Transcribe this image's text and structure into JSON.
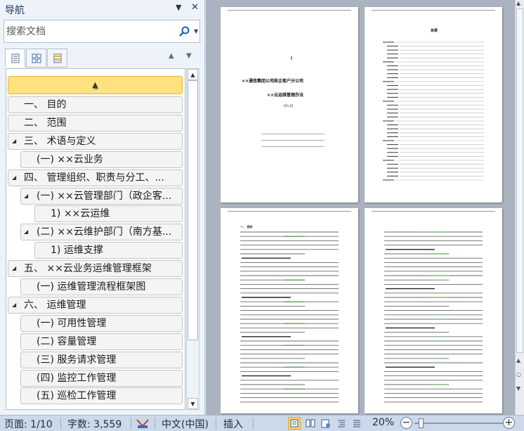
{
  "nav": {
    "title": "导航",
    "search": {
      "placeholder": "搜索文档"
    },
    "view_tabs": [
      "headings-view",
      "pages-view",
      "results-view"
    ],
    "headings": [
      {
        "level": 1,
        "label": "一、 目的",
        "expandable": false
      },
      {
        "level": 1,
        "label": "二、 范围",
        "expandable": false
      },
      {
        "level": 1,
        "label": "三、 术语与定义",
        "expandable": true
      },
      {
        "level": 2,
        "label": "(一) ××云业务",
        "expandable": false
      },
      {
        "level": 1,
        "label": "四、 管理组织、职责与分工、...",
        "expandable": true
      },
      {
        "level": 2,
        "label": "(一) ××云管理部门（政企客...",
        "expandable": true
      },
      {
        "level": 3,
        "label": "1) ××云运维",
        "expandable": false
      },
      {
        "level": 2,
        "label": "(二) ××云维护部门（南方基...",
        "expandable": true
      },
      {
        "level": 3,
        "label": "1) 运维支撑",
        "expandable": false
      },
      {
        "level": 1,
        "label": "五、 ××云业务运维管理框架",
        "expandable": true
      },
      {
        "level": 2,
        "label": "(一) 运维管理流程框架图",
        "expandable": false
      },
      {
        "level": 1,
        "label": "六、 运维管理",
        "expandable": true
      },
      {
        "level": 2,
        "label": "(一) 可用性管理",
        "expandable": false
      },
      {
        "level": 2,
        "label": "(二) 容量管理",
        "expandable": false
      },
      {
        "level": 2,
        "label": "(三) 服务请求管理",
        "expandable": false
      },
      {
        "level": 2,
        "label": "(四) 监控工作管理",
        "expandable": false
      },
      {
        "level": 2,
        "label": "(五) 巡检工作管理",
        "expandable": false
      }
    ]
  },
  "document": {
    "cover_title": "××通信集团公司政企客户分公司",
    "cover_subtitle": "××云运维管理办法",
    "version": "【V1.0】",
    "toc_title": "目录",
    "section1": "一、 目的",
    "section_terms": "三、 术语与定义",
    "section_org": "四、 管理组织、职责与分工、角色",
    "sub_org": "(一) ××云管理部门",
    "sub_maint": "(二) ××云维护部门（南方基地运维支撑）",
    "sub_ops": "1) 运维支撑"
  },
  "status": {
    "page": "页面: 1/10",
    "words": "字数: 3,559",
    "language": "中文(中国)",
    "mode": "插入",
    "zoom": "20%",
    "zoom_level_percent": 20
  },
  "colors": {
    "accent": "#fde27d",
    "pane_bg": "#eef3fa",
    "status_bg": "#ccd9ea",
    "doc_bg": "#aab3bf"
  }
}
